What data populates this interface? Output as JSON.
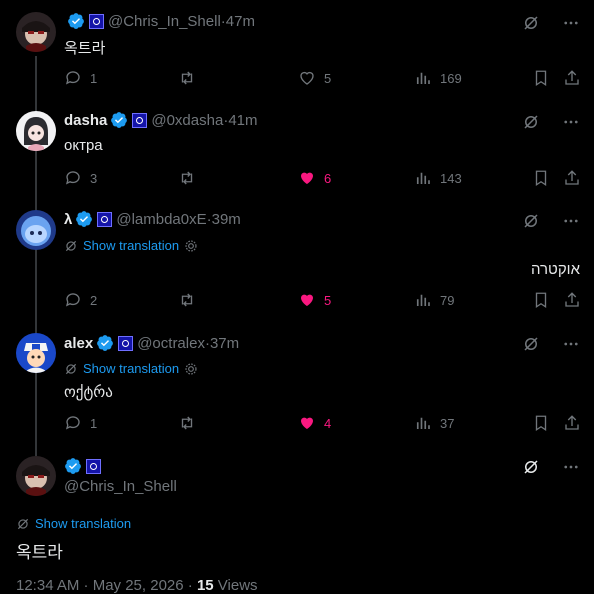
{
  "tweets": [
    {
      "name": "",
      "handle": "@Chris_In_Shell",
      "time": "47m",
      "text": "옥트라",
      "replies": "1",
      "likes": "5",
      "views": "169",
      "liked": false
    },
    {
      "name": "dasha",
      "handle": "@0xdasha",
      "time": "41m",
      "text": "октра",
      "replies": "3",
      "likes": "6",
      "views": "143",
      "liked": true
    },
    {
      "name": "λ",
      "handle": "@lambda0xE",
      "time": "39m",
      "show_translation": "Show translation",
      "text": "אוקטרה",
      "replies": "2",
      "likes": "5",
      "views": "79",
      "liked": true
    },
    {
      "name": "alex",
      "handle": "@octralex",
      "time": "37m",
      "show_translation": "Show translation",
      "text": "ოქტრა",
      "replies": "1",
      "likes": "4",
      "views": "37",
      "liked": true
    }
  ],
  "main": {
    "handle": "@Chris_In_Shell",
    "show_translation": "Show translation",
    "text": "옥트라",
    "timestamp": "12:34 AM · May 25, 2026 · ",
    "views_count": "15",
    "views_label": " Views"
  },
  "separator": " · ",
  "colors": {
    "like": "#f91880",
    "link": "#1d9bf0",
    "muted": "#71767b",
    "verified": "#1d9bf0"
  },
  "icons": [
    "grok-icon",
    "more-icon",
    "reply-icon",
    "retweet-icon",
    "like-icon",
    "views-icon",
    "bookmark-icon",
    "share-icon",
    "verified-icon",
    "translate-icon"
  ]
}
